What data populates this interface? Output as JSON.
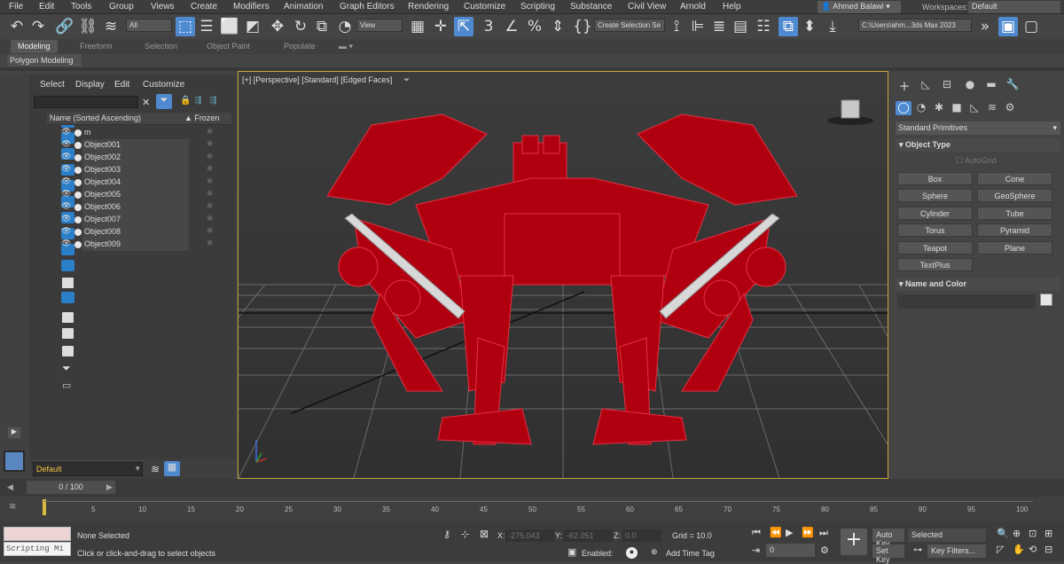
{
  "menu": [
    "File",
    "Edit",
    "Tools",
    "Group",
    "Views",
    "Create",
    "Modifiers",
    "Animation",
    "Graph Editors",
    "Rendering",
    "Customize",
    "Scripting",
    "Substance",
    "Civil View",
    "Arnold",
    "Help"
  ],
  "user": "Ahmed Balawi ▾",
  "workspaces_label": "Workspaces:",
  "workspace": "Default",
  "toolbar": {
    "selection_filter": "All",
    "ref_coord": "View",
    "named_selection": "Create Selection Se",
    "path": "C:\\Users\\ahm...3ds Max 2023"
  },
  "ribbon_tabs": [
    "Modeling",
    "Freeform",
    "Selection",
    "Object Paint",
    "Populate"
  ],
  "ribbon_sub": "Polygon Modeling",
  "scene_explorer": {
    "menu": [
      "Select",
      "Display",
      "Edit",
      "Customize"
    ],
    "col_name": "Name (Sorted Ascending)",
    "col_frozen": "▲ Frozen",
    "objects": [
      "m",
      "Object001",
      "Object002",
      "Object003",
      "Object004",
      "Object005",
      "Object006",
      "Object007",
      "Object008",
      "Object009"
    ]
  },
  "layer": "Default",
  "viewport_label": "[+] [Perspective] [Standard] [Edged Faces]",
  "command_panel": {
    "category": "Standard Primitives",
    "object_type": "Object Type",
    "autogrid": "AutoGrid",
    "buttons": [
      "Box",
      "Cone",
      "Sphere",
      "GeoSphere",
      "Cylinder",
      "Tube",
      "Torus",
      "Pyramid",
      "Teapot",
      "Plane",
      "TextPlus"
    ],
    "name_color": "Name and Color"
  },
  "time_slider": "0 / 100",
  "ruler_ticks": [
    "5",
    "10",
    "15",
    "20",
    "25",
    "30",
    "35",
    "40",
    "45",
    "50",
    "55",
    "60",
    "65",
    "70",
    "75",
    "80",
    "85",
    "90",
    "95",
    "100"
  ],
  "status": {
    "script_mini": "Scripting Mi",
    "selection": "None Selected",
    "prompt": "Click or click-and-drag to select objects",
    "x_label": "X:",
    "x": "-275.043",
    "y_label": "Y:",
    "y": "-62.051",
    "z_label": "Z:",
    "z": "0.0",
    "grid": "Grid = 10.0",
    "enabled": "Enabled:",
    "add_time_tag": "Add Time Tag",
    "auto_key": "Auto Key",
    "selected": "Selected",
    "set_key": "Set Key",
    "key_filters": "Key Filters...",
    "frame": "0"
  },
  "colors": {
    "accent": "#4f8ad0",
    "model": "#b00010",
    "viewport_border": "#c8a63a"
  }
}
